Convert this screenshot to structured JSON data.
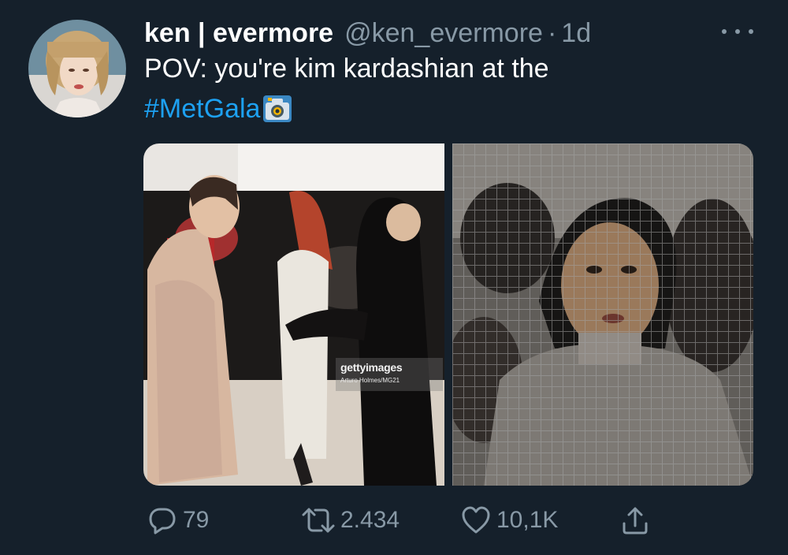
{
  "tweet": {
    "display_name": "ken | evermore",
    "handle": "@ken_evermore",
    "separator": "·",
    "timestamp": "1d",
    "text_line1": "POV: you're kim kardashian at the",
    "hashtag": "#MetGala",
    "emoji": "camera-emoji"
  },
  "media": {
    "watermark_brand": "gettyimages",
    "watermark_credit": "Arturo Holmes/MG21"
  },
  "actions": {
    "replies": "79",
    "retweets": "2.434",
    "likes": "10,1K"
  },
  "icons": {
    "reply": "reply-icon",
    "retweet": "retweet-icon",
    "like": "heart-icon",
    "share": "share-icon",
    "more": "more-icon"
  },
  "colors": {
    "background": "#15202b",
    "secondary_text": "#8899a6",
    "link": "#1da1f2"
  }
}
